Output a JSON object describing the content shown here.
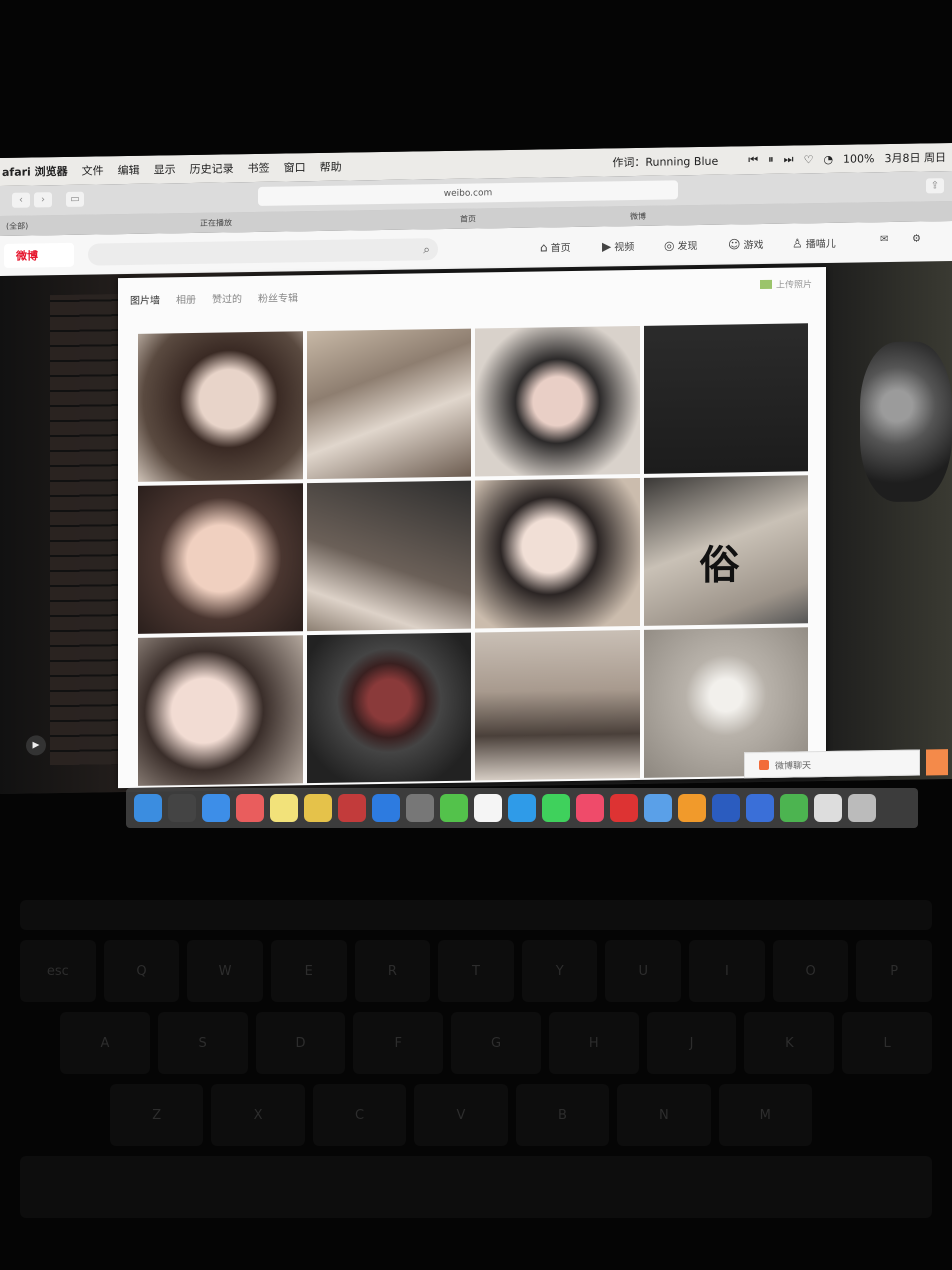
{
  "menubar": {
    "app_name": "afari 浏览器",
    "items": [
      "文件",
      "编辑",
      "显示",
      "历史记录",
      "书签",
      "窗口",
      "帮助"
    ],
    "now_playing": "作词：Running Blue",
    "battery": "100%",
    "date": "3月8日 周日"
  },
  "browser": {
    "url": "weibo.com",
    "tabs": [
      "(全部)",
      "正在播放",
      "首页",
      "微博"
    ]
  },
  "weibo": {
    "logo": "微博",
    "nav": [
      {
        "icon": "home-icon",
        "glyph": "⌂",
        "label": "首页"
      },
      {
        "icon": "video-icon",
        "glyph": "▶",
        "label": "视频"
      },
      {
        "icon": "discover-icon",
        "glyph": "◎",
        "label": "发现"
      },
      {
        "icon": "game-icon",
        "glyph": "☺",
        "label": "游戏"
      },
      {
        "icon": "user-icon",
        "glyph": "♙",
        "label": "播喵儿"
      }
    ]
  },
  "album": {
    "tabs": [
      "图片墙",
      "相册",
      "赞过的",
      "粉丝专辑"
    ],
    "upload_label": "上传照片",
    "calligraphy": "俗"
  },
  "chat": {
    "label": "微博聊天"
  },
  "dock": {
    "apps": [
      "#3b8de0",
      "#444",
      "#3d8ee8",
      "#e95d5d",
      "#f2e27a",
      "#e5c24a",
      "#c23b3b",
      "#2d7be0",
      "#777",
      "#53c24b",
      "#f5f5f5",
      "#2f9be8",
      "#3fd15c",
      "#ef4b6a",
      "#d33",
      "#5aa0e8",
      "#f19a2b",
      "#2b5cbf",
      "#3a6fd8",
      "#4cb450",
      "#ddd",
      "#bbb"
    ]
  },
  "keyboard": {
    "row1": [
      "esc",
      "Q",
      "W",
      "E",
      "R",
      "T",
      "Y",
      "U",
      "I",
      "O",
      "P"
    ],
    "row2": [
      "A",
      "S",
      "D",
      "F",
      "G",
      "H",
      "J",
      "K",
      "L"
    ],
    "row3": [
      "Z",
      "X",
      "C",
      "V",
      "B",
      "N",
      "M"
    ]
  }
}
